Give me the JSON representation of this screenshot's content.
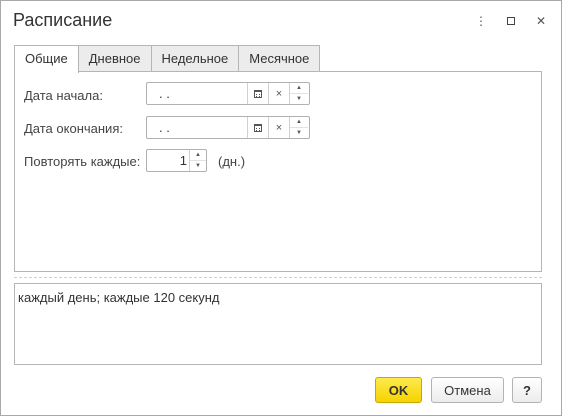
{
  "window": {
    "title": "Расписание",
    "more_glyph": "⋮",
    "close_glyph": "✕"
  },
  "tabs": [
    {
      "label": "Общие",
      "active": true
    },
    {
      "label": "Дневное",
      "active": false
    },
    {
      "label": "Недельное",
      "active": false
    },
    {
      "label": "Месячное",
      "active": false
    }
  ],
  "form": {
    "start_date": {
      "label": "Дата начала:",
      "value": " .  ."
    },
    "end_date": {
      "label": "Дата окончания:",
      "value": " .  ."
    },
    "repeat": {
      "label": "Повторять каждые:",
      "value": "1",
      "unit": "(дн.)"
    },
    "clear_glyph": "×",
    "spin_up": "▲",
    "spin_down": "▼"
  },
  "description": "каждый день; каждые 120 секунд",
  "buttons": {
    "ok": "OK",
    "cancel": "Отмена",
    "help": "?"
  },
  "colors": {
    "ok_button": "#f6d300",
    "tab_inactive": "#ececec",
    "border": "#b5b5b5"
  },
  "icons": [
    "more-icon",
    "maximize-icon",
    "close-icon",
    "calendar-icon",
    "clear-icon",
    "spin-up-icon",
    "spin-down-icon"
  ]
}
